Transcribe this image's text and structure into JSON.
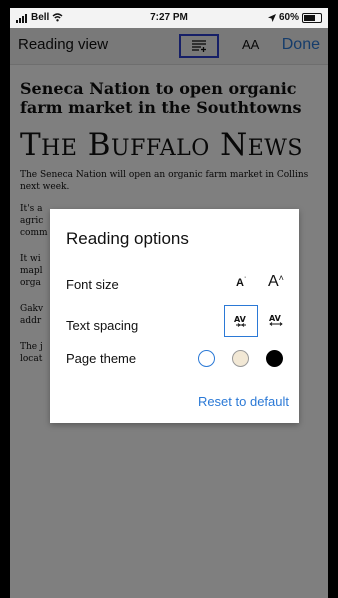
{
  "status_bar": {
    "carrier": "Bell",
    "time": "7:27 PM",
    "battery": "60%"
  },
  "toolbar": {
    "title": "Reading view",
    "aa_label": "AA",
    "done_label": "Done"
  },
  "article": {
    "headline": "Seneca Nation to open organic farm market in the Southtowns",
    "masthead": "The Buffalo News",
    "paragraphs": [
      "The Seneca Nation will open an organic farm market in Collins next week.",
      "It's a agric comm",
      "It wi mapl orga",
      "Gakv addr",
      "The j locat"
    ]
  },
  "reading_options": {
    "title": "Reading options",
    "font_size_label": "Font size",
    "font_small_glyph": "A",
    "font_large_glyph": "A",
    "text_spacing_label": "Text spacing",
    "page_theme_label": "Page theme",
    "theme_colors": [
      "#ffffff",
      "#f2e8d5",
      "#000000"
    ],
    "accent_color": "#2b79d6",
    "reset_label": "Reset to default"
  }
}
